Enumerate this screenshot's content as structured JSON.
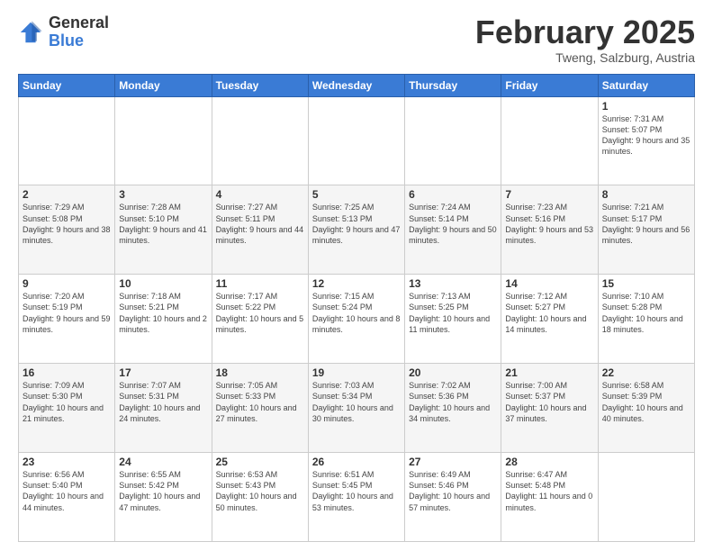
{
  "header": {
    "logo": {
      "general": "General",
      "blue": "Blue"
    },
    "title": "February 2025",
    "subtitle": "Tweng, Salzburg, Austria"
  },
  "weekdays": [
    "Sunday",
    "Monday",
    "Tuesday",
    "Wednesday",
    "Thursday",
    "Friday",
    "Saturday"
  ],
  "weeks": [
    [
      {
        "num": "",
        "info": ""
      },
      {
        "num": "",
        "info": ""
      },
      {
        "num": "",
        "info": ""
      },
      {
        "num": "",
        "info": ""
      },
      {
        "num": "",
        "info": ""
      },
      {
        "num": "",
        "info": ""
      },
      {
        "num": "1",
        "info": "Sunrise: 7:31 AM\nSunset: 5:07 PM\nDaylight: 9 hours and 35 minutes."
      }
    ],
    [
      {
        "num": "2",
        "info": "Sunrise: 7:29 AM\nSunset: 5:08 PM\nDaylight: 9 hours and 38 minutes."
      },
      {
        "num": "3",
        "info": "Sunrise: 7:28 AM\nSunset: 5:10 PM\nDaylight: 9 hours and 41 minutes."
      },
      {
        "num": "4",
        "info": "Sunrise: 7:27 AM\nSunset: 5:11 PM\nDaylight: 9 hours and 44 minutes."
      },
      {
        "num": "5",
        "info": "Sunrise: 7:25 AM\nSunset: 5:13 PM\nDaylight: 9 hours and 47 minutes."
      },
      {
        "num": "6",
        "info": "Sunrise: 7:24 AM\nSunset: 5:14 PM\nDaylight: 9 hours and 50 minutes."
      },
      {
        "num": "7",
        "info": "Sunrise: 7:23 AM\nSunset: 5:16 PM\nDaylight: 9 hours and 53 minutes."
      },
      {
        "num": "8",
        "info": "Sunrise: 7:21 AM\nSunset: 5:17 PM\nDaylight: 9 hours and 56 minutes."
      }
    ],
    [
      {
        "num": "9",
        "info": "Sunrise: 7:20 AM\nSunset: 5:19 PM\nDaylight: 9 hours and 59 minutes."
      },
      {
        "num": "10",
        "info": "Sunrise: 7:18 AM\nSunset: 5:21 PM\nDaylight: 10 hours and 2 minutes."
      },
      {
        "num": "11",
        "info": "Sunrise: 7:17 AM\nSunset: 5:22 PM\nDaylight: 10 hours and 5 minutes."
      },
      {
        "num": "12",
        "info": "Sunrise: 7:15 AM\nSunset: 5:24 PM\nDaylight: 10 hours and 8 minutes."
      },
      {
        "num": "13",
        "info": "Sunrise: 7:13 AM\nSunset: 5:25 PM\nDaylight: 10 hours and 11 minutes."
      },
      {
        "num": "14",
        "info": "Sunrise: 7:12 AM\nSunset: 5:27 PM\nDaylight: 10 hours and 14 minutes."
      },
      {
        "num": "15",
        "info": "Sunrise: 7:10 AM\nSunset: 5:28 PM\nDaylight: 10 hours and 18 minutes."
      }
    ],
    [
      {
        "num": "16",
        "info": "Sunrise: 7:09 AM\nSunset: 5:30 PM\nDaylight: 10 hours and 21 minutes."
      },
      {
        "num": "17",
        "info": "Sunrise: 7:07 AM\nSunset: 5:31 PM\nDaylight: 10 hours and 24 minutes."
      },
      {
        "num": "18",
        "info": "Sunrise: 7:05 AM\nSunset: 5:33 PM\nDaylight: 10 hours and 27 minutes."
      },
      {
        "num": "19",
        "info": "Sunrise: 7:03 AM\nSunset: 5:34 PM\nDaylight: 10 hours and 30 minutes."
      },
      {
        "num": "20",
        "info": "Sunrise: 7:02 AM\nSunset: 5:36 PM\nDaylight: 10 hours and 34 minutes."
      },
      {
        "num": "21",
        "info": "Sunrise: 7:00 AM\nSunset: 5:37 PM\nDaylight: 10 hours and 37 minutes."
      },
      {
        "num": "22",
        "info": "Sunrise: 6:58 AM\nSunset: 5:39 PM\nDaylight: 10 hours and 40 minutes."
      }
    ],
    [
      {
        "num": "23",
        "info": "Sunrise: 6:56 AM\nSunset: 5:40 PM\nDaylight: 10 hours and 44 minutes."
      },
      {
        "num": "24",
        "info": "Sunrise: 6:55 AM\nSunset: 5:42 PM\nDaylight: 10 hours and 47 minutes."
      },
      {
        "num": "25",
        "info": "Sunrise: 6:53 AM\nSunset: 5:43 PM\nDaylight: 10 hours and 50 minutes."
      },
      {
        "num": "26",
        "info": "Sunrise: 6:51 AM\nSunset: 5:45 PM\nDaylight: 10 hours and 53 minutes."
      },
      {
        "num": "27",
        "info": "Sunrise: 6:49 AM\nSunset: 5:46 PM\nDaylight: 10 hours and 57 minutes."
      },
      {
        "num": "28",
        "info": "Sunrise: 6:47 AM\nSunset: 5:48 PM\nDaylight: 11 hours and 0 minutes."
      },
      {
        "num": "",
        "info": ""
      }
    ]
  ]
}
